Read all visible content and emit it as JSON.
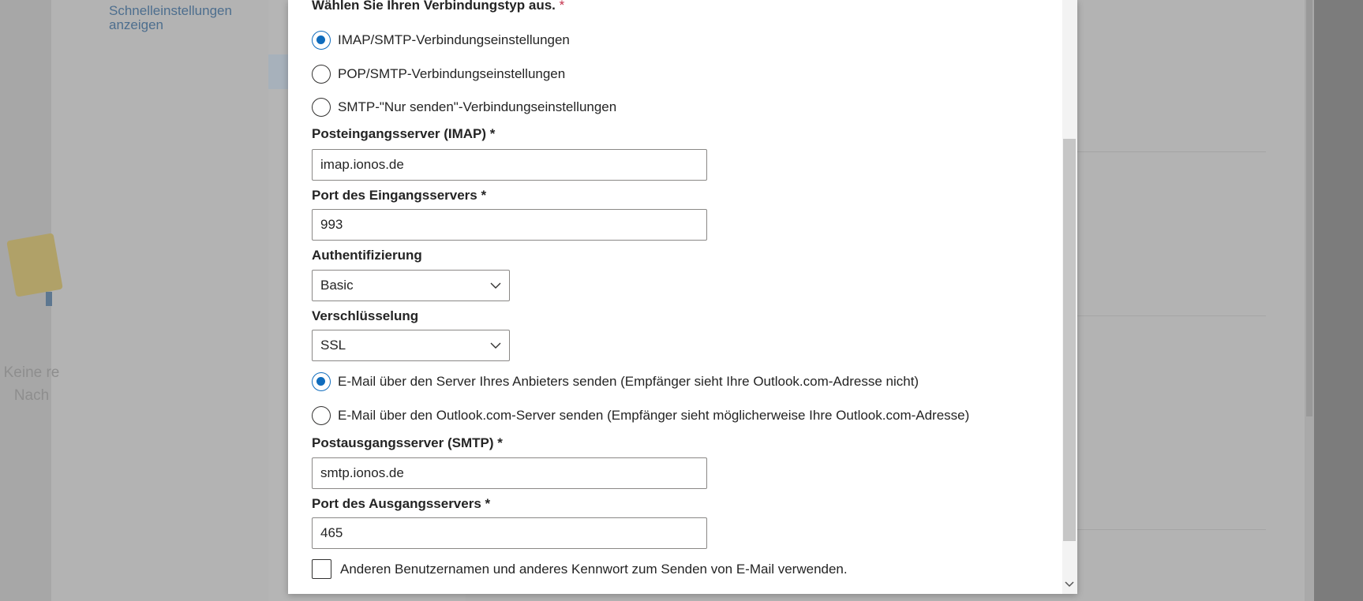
{
  "background": {
    "nav_link": "Schnelleinstellungen anzeigen",
    "empty_text_line1": "Keine re",
    "empty_text_line2": "Nach"
  },
  "dialog": {
    "connection_type_label": "Wählen Sie Ihren Verbindungstyp aus.",
    "required_marker": "*",
    "connection_types": [
      {
        "label": "IMAP/SMTP-Verbindungseinstellungen",
        "selected": true
      },
      {
        "label": "POP/SMTP-Verbindungseinstellungen",
        "selected": false
      },
      {
        "label": "SMTP-\"Nur senden\"-Verbindungseinstellungen",
        "selected": false
      }
    ],
    "incoming_server": {
      "label": "Posteingangsserver (IMAP) *",
      "value": "imap.ionos.de"
    },
    "incoming_port": {
      "label": "Port des Eingangsservers *",
      "value": "993"
    },
    "authentication": {
      "label": "Authentifizierung",
      "value": "Basic"
    },
    "encryption": {
      "label": "Verschlüsselung",
      "value": "SSL"
    },
    "send_options": [
      {
        "label": "E-Mail über den Server Ihres Anbieters senden (Empfänger sieht Ihre Outlook.com-Adresse nicht)",
        "selected": true
      },
      {
        "label": "E-Mail über den Outlook.com-Server senden (Empfänger sieht möglicherweise Ihre Outlook.com-Adresse)",
        "selected": false
      }
    ],
    "outgoing_server": {
      "label": "Postausgangsserver (SMTP) *",
      "value": "smtp.ionos.de"
    },
    "outgoing_port": {
      "label": "Port des Ausgangsservers *",
      "value": "465"
    },
    "different_credentials": {
      "label": "Anderen Benutzernamen und anderes Kennwort zum Senden von E-Mail verwenden.",
      "checked": false
    }
  },
  "colors": {
    "accent": "#0f6cbd",
    "required": "#c4314b",
    "overlay": "#7a7a7a"
  },
  "icons": {
    "dropdown": "chevron-down-icon",
    "scroll_down": "chevron-down-icon"
  }
}
